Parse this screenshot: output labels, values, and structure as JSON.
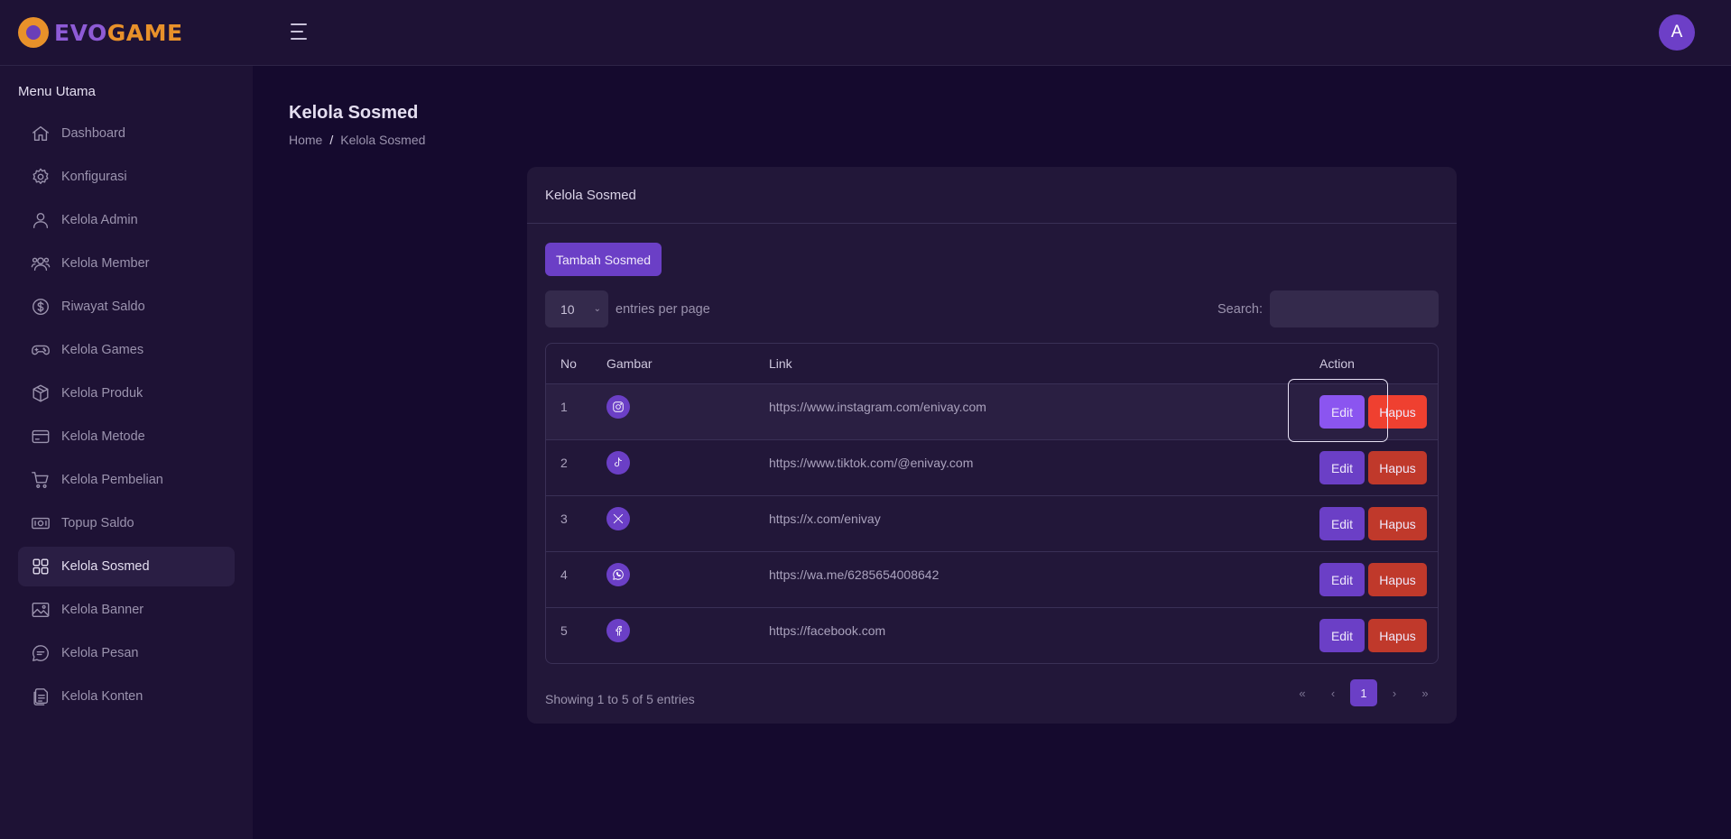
{
  "app": {
    "logo_part1": "EVO",
    "logo_part2": "GAME",
    "avatar_initial": "A"
  },
  "sidebar": {
    "heading": "Menu Utama",
    "items": [
      {
        "label": "Dashboard",
        "icon": "home-icon"
      },
      {
        "label": "Konfigurasi",
        "icon": "gear-icon"
      },
      {
        "label": "Kelola Admin",
        "icon": "user-icon"
      },
      {
        "label": "Kelola Member",
        "icon": "users-icon"
      },
      {
        "label": "Riwayat Saldo",
        "icon": "dollar-icon"
      },
      {
        "label": "Kelola Games",
        "icon": "gamepad-icon"
      },
      {
        "label": "Kelola Produk",
        "icon": "box-icon"
      },
      {
        "label": "Kelola Metode",
        "icon": "card-icon"
      },
      {
        "label": "Kelola Pembelian",
        "icon": "cart-icon"
      },
      {
        "label": "Topup Saldo",
        "icon": "cash-icon"
      },
      {
        "label": "Kelola Sosmed",
        "icon": "grid-icon",
        "active": true
      },
      {
        "label": "Kelola Banner",
        "icon": "image-icon"
      },
      {
        "label": "Kelola Pesan",
        "icon": "message-icon"
      },
      {
        "label": "Kelola Konten",
        "icon": "document-icon"
      }
    ]
  },
  "page": {
    "title": "Kelola Sosmed",
    "breadcrumb": {
      "home": "Home",
      "sep": "/",
      "current": "Kelola Sosmed"
    }
  },
  "card": {
    "title": "Kelola Sosmed",
    "add_button": "Tambah Sosmed",
    "entries_value": "10",
    "entries_label": "entries per page",
    "search_label": "Search:",
    "search_value": "",
    "columns": {
      "no": "No",
      "image": "Gambar",
      "link": "Link",
      "action": "Action"
    },
    "rows": [
      {
        "no": "1",
        "icon": "instagram-icon",
        "link": "https://www.instagram.com/enivay.com"
      },
      {
        "no": "2",
        "icon": "tiktok-icon",
        "link": "https://www.tiktok.com/@enivay.com"
      },
      {
        "no": "3",
        "icon": "x-icon",
        "link": "https://x.com/enivay"
      },
      {
        "no": "4",
        "icon": "whatsapp-icon",
        "link": "https://wa.me/6285654008642"
      },
      {
        "no": "5",
        "icon": "facebook-icon",
        "link": "https://facebook.com"
      }
    ],
    "edit_label": "Edit",
    "delete_label": "Hapus",
    "showing": "Showing 1 to 5 of 5 entries",
    "pager": {
      "first": "«",
      "prev": "‹",
      "current": "1",
      "next": "›",
      "last": "»"
    }
  },
  "colors": {
    "background": "#150a2e",
    "panel": "#1e1235",
    "accent": "#6b3fc6",
    "danger": "#c0392b",
    "logo_orange": "#e8912a"
  }
}
